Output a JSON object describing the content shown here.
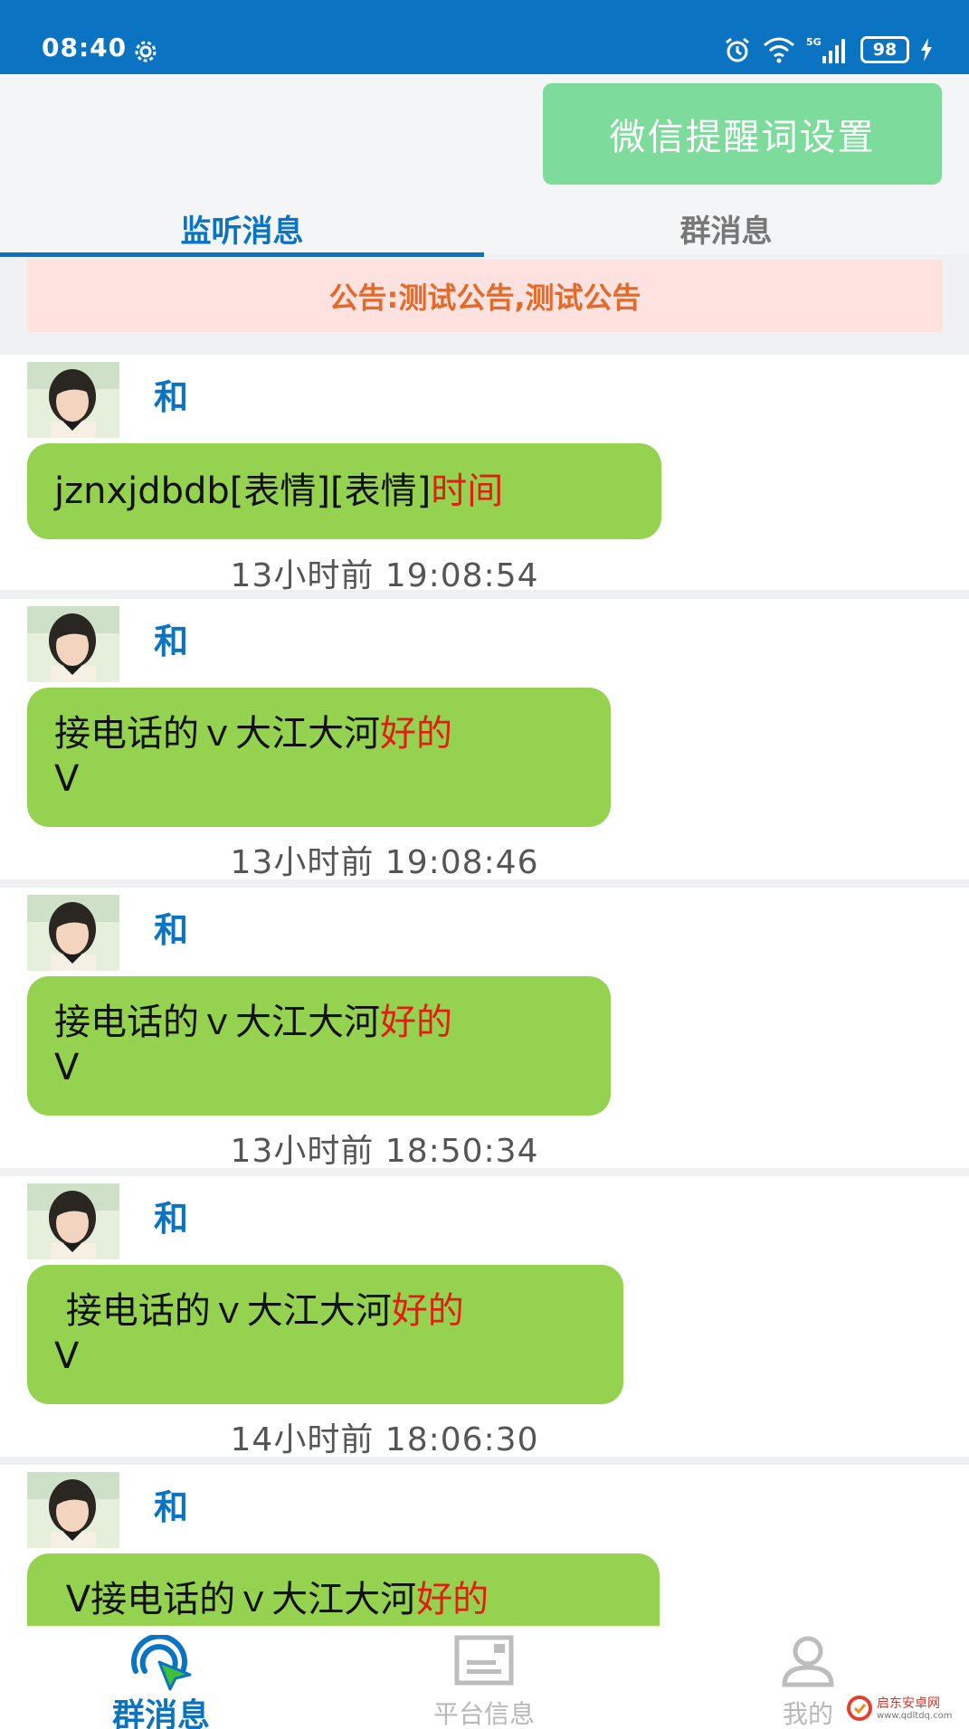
{
  "status_bar": {
    "time": "08:40",
    "network": "5G",
    "battery": "98"
  },
  "header": {
    "keyword_button": "微信提醒词设置"
  },
  "tabs": [
    {
      "label": "监听消息",
      "active": true
    },
    {
      "label": "群消息",
      "active": false
    }
  ],
  "notice": "公告:测试公告,测试公告",
  "messages": [
    {
      "sender": "和",
      "text": "jznxjdbdb[表情][表情]",
      "highlight": "时间",
      "tail": "",
      "time": "13小时前 19:08:54"
    },
    {
      "sender": "和",
      "text": "接电话的ｖ大江大河",
      "highlight": "好的",
      "tail": "V",
      "time": "13小时前 19:08:46"
    },
    {
      "sender": "和",
      "text": "接电话的ｖ大江大河",
      "highlight": "好的",
      "tail": "V",
      "time": "13小时前 18:50:34"
    },
    {
      "sender": "和",
      "text": " 接电话的ｖ大江大河",
      "highlight": "好的",
      "tail": "V",
      "time": "14小时前 18:06:30"
    },
    {
      "sender": "和",
      "text": " V接电话的ｖ大江大河",
      "highlight": "好的",
      "tail": "",
      "time": ""
    }
  ],
  "bottom_nav": [
    {
      "label": "群消息",
      "icon": "radar-cursor-icon",
      "active": true
    },
    {
      "label": "平台信息",
      "icon": "document-icon",
      "active": false
    },
    {
      "label": "我的",
      "icon": "user-icon",
      "active": false
    }
  ],
  "watermark": {
    "title": "启东安卓网",
    "url": "www.qdltdq.com"
  },
  "colors": {
    "primary": "#0a73c2",
    "bubble": "#94d250",
    "highlight": "#e21d12",
    "button": "#7ddb9c",
    "notice_bg": "#fde2e0",
    "notice_text": "#e56a2a"
  }
}
